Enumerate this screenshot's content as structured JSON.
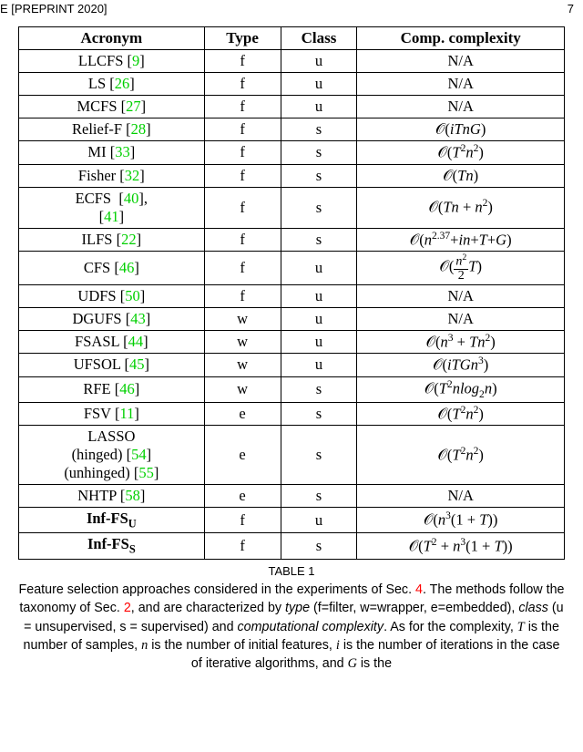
{
  "header": {
    "left": "E [PREPRINT 2020]",
    "right": "7"
  },
  "table": {
    "headers": [
      "Acronym",
      "Type",
      "Class",
      "Comp. complexity"
    ],
    "rows": [
      {
        "acronym_plain": "LLCFS",
        "refs": [
          "9"
        ],
        "type": "f",
        "class": "u",
        "complexity": "N/A"
      },
      {
        "acronym_plain": "LS",
        "refs": [
          "26"
        ],
        "type": "f",
        "class": "u",
        "complexity": "N/A"
      },
      {
        "acronym_plain": "MCFS",
        "refs": [
          "27"
        ],
        "type": "f",
        "class": "u",
        "complexity": "N/A"
      },
      {
        "acronym_plain": "Relief-F",
        "refs": [
          "28"
        ],
        "type": "f",
        "class": "s",
        "complexity": "O(iTnG)"
      },
      {
        "acronym_plain": "MI",
        "refs": [
          "33"
        ],
        "type": "f",
        "class": "s",
        "complexity": "O(T^2 n^2)"
      },
      {
        "acronym_plain": "Fisher",
        "refs": [
          "32"
        ],
        "type": "f",
        "class": "s",
        "complexity": "O(Tn)"
      },
      {
        "acronym_plain": "ECFS",
        "refs": [
          "40",
          "41"
        ],
        "type": "f",
        "class": "s",
        "complexity": "O(Tn + n^2)"
      },
      {
        "acronym_plain": "ILFS",
        "refs": [
          "22"
        ],
        "type": "f",
        "class": "s",
        "complexity": "O(n^2.37 + in + T + G)"
      },
      {
        "acronym_plain": "CFS",
        "refs": [
          "46"
        ],
        "type": "f",
        "class": "u",
        "complexity": "O((n^2/2) T)"
      },
      {
        "acronym_plain": "UDFS",
        "refs": [
          "50"
        ],
        "type": "f",
        "class": "u",
        "complexity": "N/A"
      },
      {
        "acronym_plain": "DGUFS",
        "refs": [
          "43"
        ],
        "type": "w",
        "class": "u",
        "complexity": "N/A"
      },
      {
        "acronym_plain": "FSASL",
        "refs": [
          "44"
        ],
        "type": "w",
        "class": "u",
        "complexity": "O(n^3 + Tn^2)"
      },
      {
        "acronym_plain": "UFSOL",
        "refs": [
          "45"
        ],
        "type": "w",
        "class": "u",
        "complexity": "O(iTGn^3)"
      },
      {
        "acronym_plain": "RFE",
        "refs": [
          "46"
        ],
        "type": "w",
        "class": "s",
        "complexity": "O(T^2 n log_2 n)"
      },
      {
        "acronym_plain": "FSV",
        "refs": [
          "11"
        ],
        "type": "e",
        "class": "s",
        "complexity": "O(T^2 n^2)"
      },
      {
        "acronym_plain": "LASSO",
        "sublines": [
          "(hinged)",
          "(unhinged)"
        ],
        "refs": [
          "54",
          "55"
        ],
        "type": "e",
        "class": "s",
        "complexity": "O(T^2 n^2)"
      },
      {
        "acronym_plain": "NHTP",
        "refs": [
          "58"
        ],
        "type": "e",
        "class": "s",
        "complexity": "N/A"
      },
      {
        "acronym_plain": "Inf-FS_U",
        "bold": true,
        "refs": [],
        "type": "f",
        "class": "u",
        "complexity": "O(n^3(1+T))"
      },
      {
        "acronym_plain": "Inf-FS_S",
        "bold": true,
        "refs": [],
        "type": "f",
        "class": "s",
        "complexity": "O(T^2 + n^3(1+T))"
      }
    ]
  },
  "caption": {
    "label": "TABLE 1",
    "text_parts": {
      "p1": "Feature selection approaches considered in the experiments of Sec. ",
      "sec4": "4",
      "p2": ". The methods follow the taxonomy of Sec. ",
      "sec2": "2",
      "p3": ", and are characterized by ",
      "type": "type",
      "p4": " (f=filter, w=wrapper, e=embedded), ",
      "class": "class",
      "p5": " (u = unsupervised, s = supervised) and ",
      "cc": "computational complexity",
      "p6": ". As for the complexity, ",
      "T": "T",
      "p7": " is the number of samples, ",
      "n": "n",
      "p8": " is the number of initial features, ",
      "i": "i",
      "p9": " is the number of iterations in the case of iterative algorithms, and ",
      "G": "G",
      "p10": " is the"
    }
  }
}
